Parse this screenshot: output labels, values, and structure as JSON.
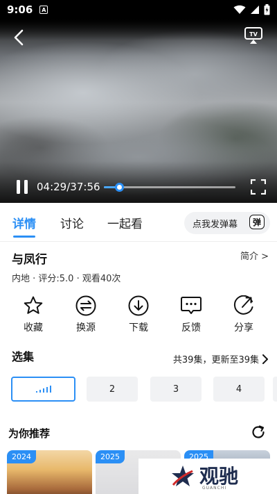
{
  "status_bar": {
    "time": "9:06",
    "notification_badge": "A"
  },
  "player": {
    "current_time": "04:29",
    "duration": "37:56",
    "time_separator": "/",
    "progress_fraction": 0.118,
    "accent_color": "#2b8ff5"
  },
  "tabs": [
    {
      "label": "详情",
      "active": true
    },
    {
      "label": "讨论",
      "active": false
    },
    {
      "label": "一起看",
      "active": false
    }
  ],
  "danmaku": {
    "placeholder": "点我发弹幕",
    "toggle_label": "弹"
  },
  "show": {
    "title": "与凤行",
    "intro_link": "简介 >",
    "meta": "内地 · 评分:5.0 · 观看40次"
  },
  "actions": [
    {
      "label": "收藏",
      "icon": "star-icon"
    },
    {
      "label": "换源",
      "icon": "switch-source-icon"
    },
    {
      "label": "下载",
      "icon": "download-icon"
    },
    {
      "label": "反馈",
      "icon": "feedback-icon"
    },
    {
      "label": "分享",
      "icon": "share-icon"
    }
  ],
  "episodes": {
    "section_title": "选集",
    "summary": "共39集，更新至39集",
    "items": [
      "",
      "2",
      "3",
      "4"
    ]
  },
  "recommend": {
    "section_title": "为你推荐",
    "cards": [
      {
        "year": "2024"
      },
      {
        "year": "2025"
      },
      {
        "year": "2025"
      }
    ]
  },
  "watermark": {
    "text": "观驰",
    "sub": "GUANCHI"
  }
}
